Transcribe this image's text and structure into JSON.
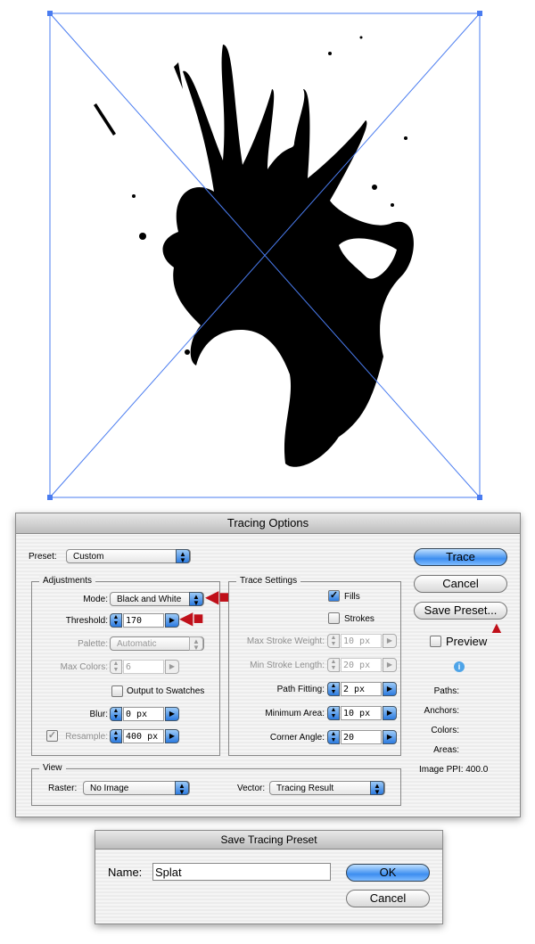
{
  "tracing_options": {
    "title": "Tracing Options",
    "preset_label": "Preset:",
    "preset_value": "Custom",
    "adjustments": {
      "title": "Adjustments",
      "mode_label": "Mode:",
      "mode_value": "Black and White",
      "threshold_label": "Threshold:",
      "threshold_value": "170",
      "palette_label": "Palette:",
      "palette_value": "Automatic",
      "max_colors_label": "Max Colors:",
      "max_colors_value": "6",
      "output_swatches_label": "Output to Swatches",
      "blur_label": "Blur:",
      "blur_value": "0 px",
      "resample_label": "Resample:",
      "resample_value": "400 px"
    },
    "trace_settings": {
      "title": "Trace Settings",
      "fills_label": "Fills",
      "strokes_label": "Strokes",
      "max_stroke_weight_label": "Max Stroke Weight:",
      "max_stroke_weight_value": "10 px",
      "min_stroke_length_label": "Min Stroke Length:",
      "min_stroke_length_value": "20 px",
      "path_fitting_label": "Path Fitting:",
      "path_fitting_value": "2 px",
      "minimum_area_label": "Minimum Area:",
      "minimum_area_value": "10 px",
      "corner_angle_label": "Corner Angle:",
      "corner_angle_value": "20"
    },
    "view": {
      "title": "View",
      "raster_label": "Raster:",
      "raster_value": "No Image",
      "vector_label": "Vector:",
      "vector_value": "Tracing Result"
    },
    "buttons": {
      "trace": "Trace",
      "cancel": "Cancel",
      "save_preset": "Save Preset..."
    },
    "preview_label": "Preview",
    "stats": {
      "paths": "Paths:",
      "anchors": "Anchors:",
      "colors": "Colors:",
      "areas": "Areas:",
      "image_ppi": "Image PPI: 400.0"
    }
  },
  "save_preset": {
    "title": "Save Tracing Preset",
    "name_label": "Name:",
    "name_value": "Splat",
    "ok": "OK",
    "cancel": "Cancel"
  },
  "colors": {
    "accent": "#2c7be0",
    "arrow": "#c0101a",
    "selection": "#4a7cf0"
  }
}
